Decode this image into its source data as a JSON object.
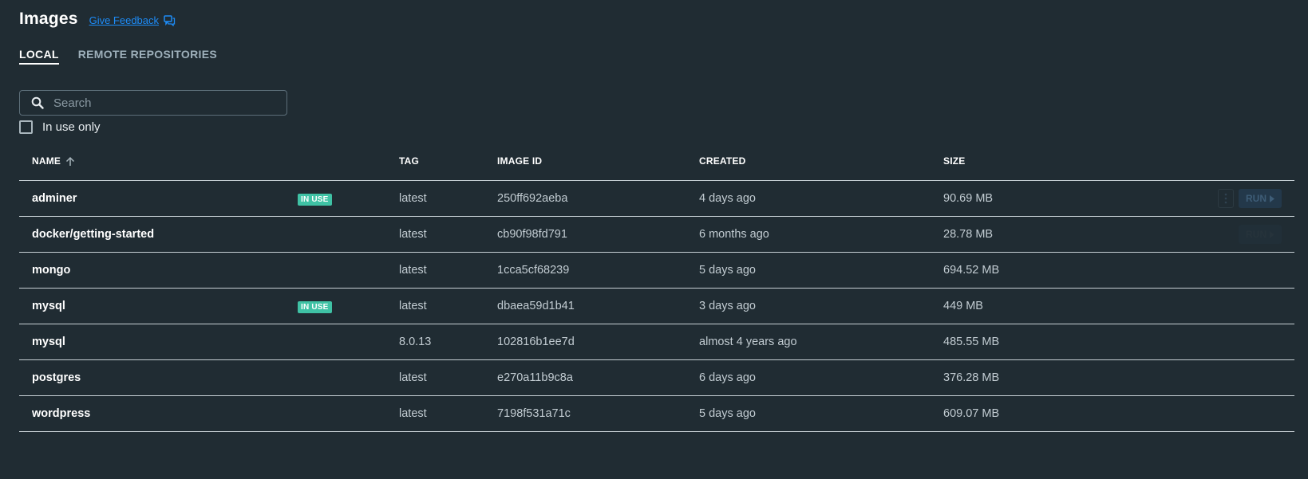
{
  "header": {
    "title": "Images",
    "feedback_label": "Give Feedback",
    "feedback_icon": "feedback-chat-icon"
  },
  "tabs": [
    {
      "label": "LOCAL",
      "active": true
    },
    {
      "label": "REMOTE REPOSITORIES",
      "active": false
    }
  ],
  "search": {
    "placeholder": "Search",
    "value": "",
    "icon": "search-icon"
  },
  "filter": {
    "label": "In use only",
    "checked": false
  },
  "table": {
    "columns": {
      "name": "NAME",
      "tag": "TAG",
      "image_id": "IMAGE ID",
      "created": "CREATED",
      "size": "SIZE"
    },
    "sort": {
      "column": "name",
      "direction": "ascending"
    },
    "badge_label": "IN USE",
    "run_label": "RUN",
    "rows": [
      {
        "name": "adminer",
        "in_use": "IN USE",
        "tag": "latest",
        "image_id": "250ff692aeba",
        "created": "4 days ago",
        "size": "90.69 MB",
        "run": "RUN"
      },
      {
        "name": "docker/getting-started",
        "in_use": "",
        "tag": "latest",
        "image_id": "cb90f98fd791",
        "created": "6 months ago",
        "size": "28.78 MB",
        "run": "RUN"
      },
      {
        "name": "mongo",
        "in_use": "",
        "tag": "latest",
        "image_id": "1cca5cf68239",
        "created": "5 days ago",
        "size": "694.52 MB"
      },
      {
        "name": "mysql",
        "in_use": "IN USE",
        "tag": "latest",
        "image_id": "dbaea59d1b41",
        "created": "3 days ago",
        "size": "449 MB"
      },
      {
        "name": "mysql",
        "in_use": "",
        "tag": "8.0.13",
        "image_id": "102816b1ee7d",
        "created": "almost 4 years ago",
        "size": "485.55 MB"
      },
      {
        "name": "postgres",
        "in_use": "",
        "tag": "latest",
        "image_id": "e270a11b9c8a",
        "created": "6 days ago",
        "size": "376.28 MB"
      },
      {
        "name": "wordpress",
        "in_use": "",
        "tag": "latest",
        "image_id": "7198f531a71c",
        "created": "5 days ago",
        "size": "609.07 MB"
      }
    ]
  },
  "colors": {
    "background": "#202c33",
    "link": "#1d8cf8",
    "badge": "#3fc2a5",
    "divider": "#c7d0d5"
  }
}
